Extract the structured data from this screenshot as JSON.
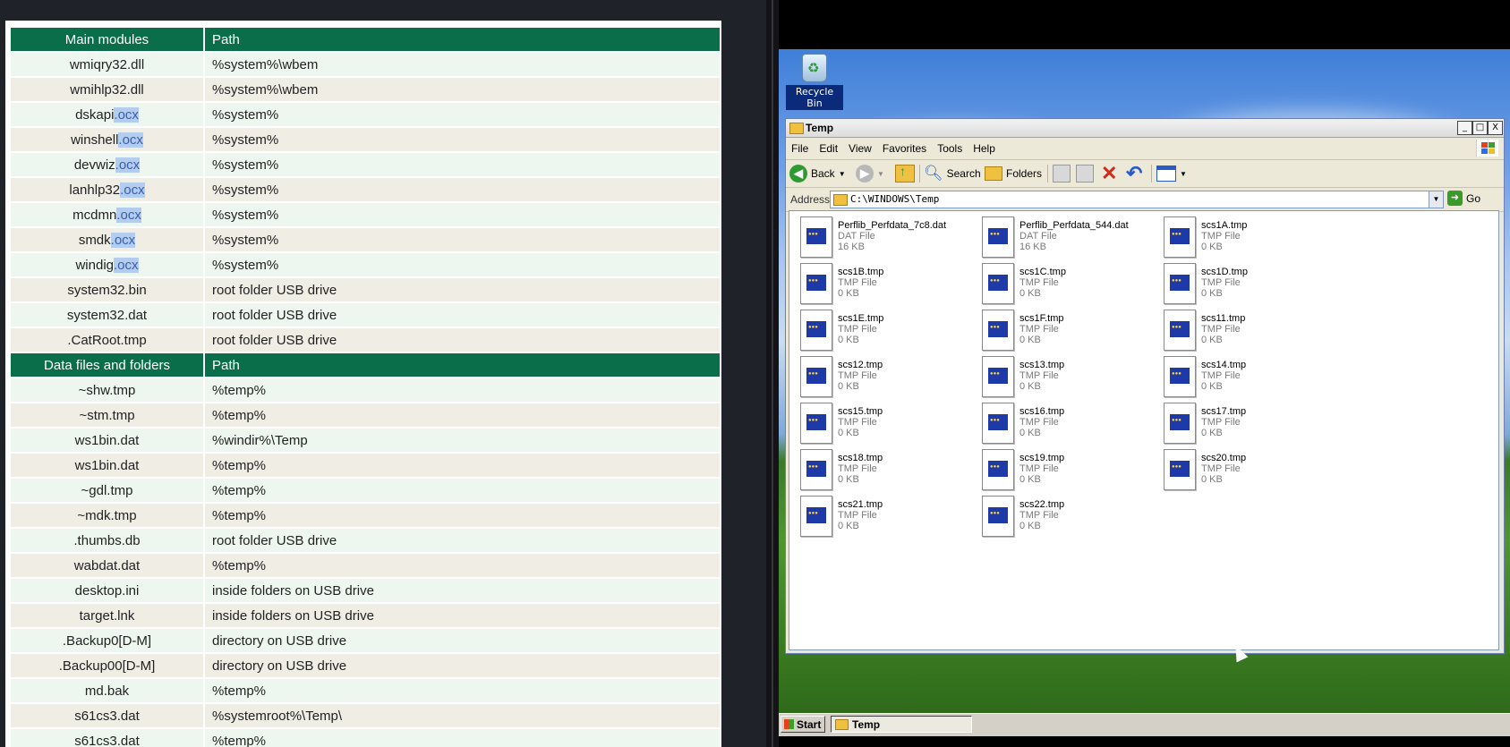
{
  "table": {
    "headers1": [
      "Main modules",
      "Path"
    ],
    "rows1": [
      {
        "name": "wmiqry32.dll",
        "path": "%system%\\wbem"
      },
      {
        "name": "wmihlp32.dll",
        "path": "%system%\\wbem"
      },
      {
        "name": "dskapi",
        "ext": ".ocx",
        "path": "%system%"
      },
      {
        "name": "winshell",
        "ext": ".ocx",
        "path": "%system%"
      },
      {
        "name": "devwiz",
        "ext": ".ocx",
        "path": "%system%"
      },
      {
        "name": "lanhlp32",
        "ext": ".ocx",
        "path": "%system%"
      },
      {
        "name": "mcdmn",
        "ext": ".ocx",
        "path": "%system%"
      },
      {
        "name": "smdk",
        "ext": ".ocx",
        "path": "%system%"
      },
      {
        "name": "windig",
        "ext": ".ocx",
        "path": "%system%"
      },
      {
        "name": "system32.bin",
        "path": "root folder USB drive"
      },
      {
        "name": "system32.dat",
        "path": "root folder USB drive"
      },
      {
        "name": ".CatRoot.tmp",
        "path": "root folder USB drive"
      }
    ],
    "headers2": [
      "Data files and folders",
      "Path"
    ],
    "rows2": [
      {
        "name": "~shw.tmp",
        "path": "%temp%"
      },
      {
        "name": "~stm.tmp",
        "path": "%temp%"
      },
      {
        "name": "ws1bin.dat",
        "path": "%windir%\\Temp"
      },
      {
        "name": "ws1bin.dat",
        "path": "%temp%"
      },
      {
        "name": "~gdl.tmp",
        "path": "%temp%"
      },
      {
        "name": "~mdk.tmp",
        "path": "%temp%"
      },
      {
        "name": ".thumbs.db",
        "path": "root folder USB drive"
      },
      {
        "name": "wabdat.dat",
        "path": "%temp%"
      },
      {
        "name": "desktop.ini",
        "path": "inside folders on USB drive"
      },
      {
        "name": "target.lnk",
        "path": "inside folders on USB drive"
      },
      {
        "name": ".Backup0[D-M]",
        "path": "directory on USB drive"
      },
      {
        "name": ".Backup00[D-M]",
        "path": "directory on USB drive"
      },
      {
        "name": "md.bak",
        "path": "%temp%"
      },
      {
        "name": "s61cs3.dat",
        "path": "%systemroot%\\Temp\\"
      },
      {
        "name": "s61cs3.dat",
        "path": "%temp%"
      }
    ]
  },
  "desktop": {
    "recycle_bin_label": "Recycle Bin"
  },
  "explorer": {
    "title": "Temp",
    "window_buttons": {
      "minimize": "_",
      "maximize": "□",
      "close": "X"
    },
    "menu": [
      "File",
      "Edit",
      "View",
      "Favorites",
      "Tools",
      "Help"
    ],
    "toolbar": {
      "back": "Back",
      "search": "Search",
      "folders": "Folders"
    },
    "address_label": "Address",
    "address_value": "C:\\WINDOWS\\Temp",
    "go_label": "Go",
    "files": [
      {
        "name": "Perflib_Perfdata_7c8.dat",
        "type": "DAT File",
        "size": "16 KB"
      },
      {
        "name": "Perflib_Perfdata_544.dat",
        "type": "DAT File",
        "size": "16 KB"
      },
      {
        "name": "scs1A.tmp",
        "type": "TMP File",
        "size": "0 KB"
      },
      {
        "name": "scs1B.tmp",
        "type": "TMP File",
        "size": "0 KB"
      },
      {
        "name": "scs1C.tmp",
        "type": "TMP File",
        "size": "0 KB"
      },
      {
        "name": "scs1D.tmp",
        "type": "TMP File",
        "size": "0 KB"
      },
      {
        "name": "scs1E.tmp",
        "type": "TMP File",
        "size": "0 KB"
      },
      {
        "name": "scs1F.tmp",
        "type": "TMP File",
        "size": "0 KB"
      },
      {
        "name": "scs11.tmp",
        "type": "TMP File",
        "size": "0 KB"
      },
      {
        "name": "scs12.tmp",
        "type": "TMP File",
        "size": "0 KB"
      },
      {
        "name": "scs13.tmp",
        "type": "TMP File",
        "size": "0 KB"
      },
      {
        "name": "scs14.tmp",
        "type": "TMP File",
        "size": "0 KB"
      },
      {
        "name": "scs15.tmp",
        "type": "TMP File",
        "size": "0 KB"
      },
      {
        "name": "scs16.tmp",
        "type": "TMP File",
        "size": "0 KB"
      },
      {
        "name": "scs17.tmp",
        "type": "TMP File",
        "size": "0 KB"
      },
      {
        "name": "scs18.tmp",
        "type": "TMP File",
        "size": "0 KB"
      },
      {
        "name": "scs19.tmp",
        "type": "TMP File",
        "size": "0 KB"
      },
      {
        "name": "scs20.tmp",
        "type": "TMP File",
        "size": "0 KB"
      },
      {
        "name": "scs21.tmp",
        "type": "TMP File",
        "size": "0 KB"
      },
      {
        "name": "scs22.tmp",
        "type": "TMP File",
        "size": "0 KB"
      }
    ]
  },
  "taskbar": {
    "start_label": "Start",
    "task_label": "Temp"
  },
  "colors": {
    "table_header": "#0a6e4a",
    "row_odd": "#edf7f0",
    "row_even": "#efede4",
    "highlight": "#b3cdf0"
  }
}
